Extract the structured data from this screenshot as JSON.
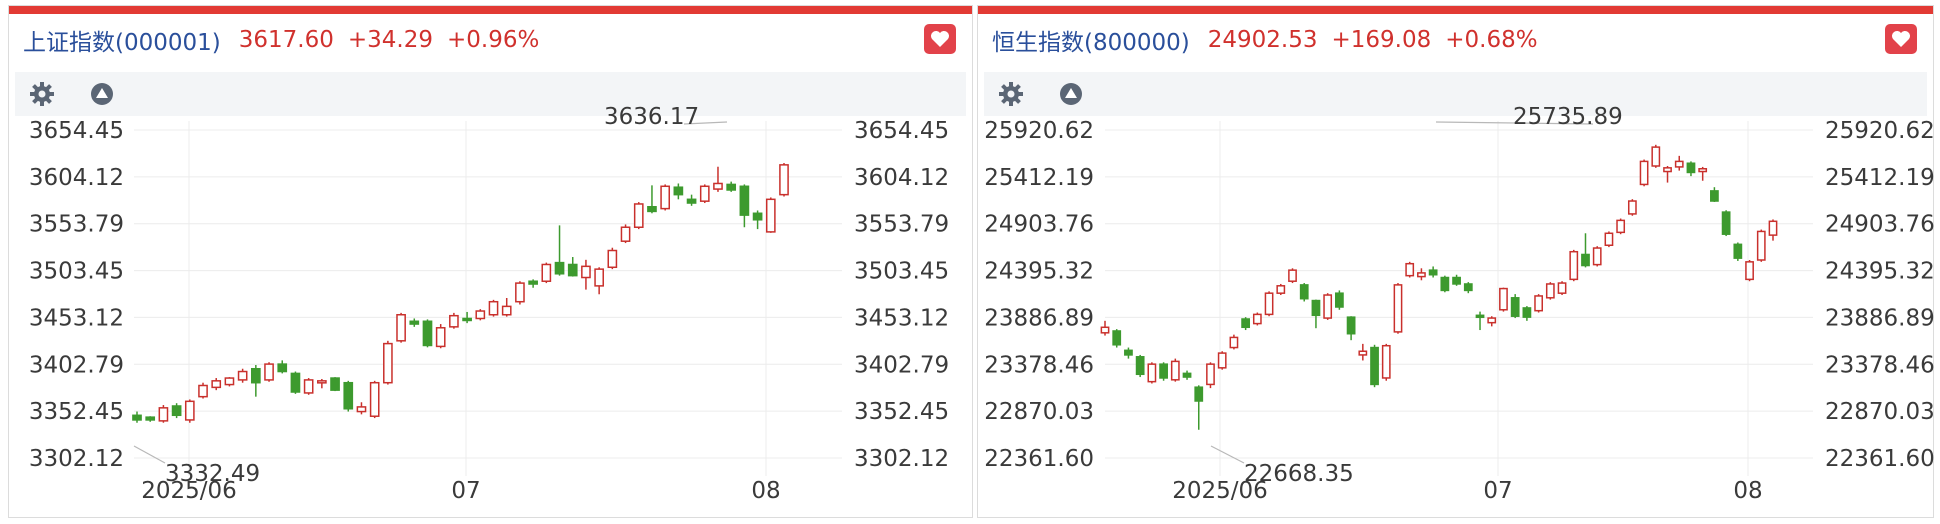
{
  "panels": [
    {
      "header": {
        "name": "上证指数(000001)",
        "price": "3617.60",
        "change": "+34.29",
        "pct": "+0.96%"
      },
      "icons": {
        "favorite": "heart-icon",
        "settings": "gear-icon",
        "toggle": "triangle-up-icon"
      },
      "chart_data": {
        "type": "candlestick",
        "y_ticks": [
          3654.45,
          3604.12,
          3553.79,
          3503.45,
          3453.12,
          3402.79,
          3352.45,
          3302.12
        ],
        "x_ticks": [
          "2025/06",
          "07",
          "08"
        ],
        "ylim": [
          3302.12,
          3654.45
        ],
        "annotations": [
          {
            "label": "3636.17",
            "at": 41
          },
          {
            "label": "3332.49",
            "at": 0
          }
        ],
        "candles": [
          [
            3348,
            3343,
            3352,
            3340
          ],
          [
            3346,
            3343,
            3347,
            3341
          ],
          [
            3342,
            3356,
            3359,
            3340
          ],
          [
            3358,
            3348,
            3361,
            3345
          ],
          [
            3343,
            3363,
            3365,
            3340
          ],
          [
            3368,
            3380,
            3383,
            3366
          ],
          [
            3378,
            3385,
            3388,
            3375
          ],
          [
            3381,
            3388,
            3389,
            3379
          ],
          [
            3386,
            3395,
            3398,
            3383
          ],
          [
            3398,
            3383,
            3402,
            3368
          ],
          [
            3386,
            3403,
            3405,
            3384
          ],
          [
            3403,
            3395,
            3407,
            3393
          ],
          [
            3393,
            3373,
            3395,
            3371
          ],
          [
            3372,
            3386,
            3388,
            3370
          ],
          [
            3383,
            3385,
            3387,
            3377
          ],
          [
            3388,
            3375,
            3389,
            3374
          ],
          [
            3383,
            3355,
            3385,
            3352
          ],
          [
            3352,
            3357,
            3362,
            3349
          ],
          [
            3347,
            3383,
            3385,
            3345
          ],
          [
            3383,
            3425,
            3428,
            3381
          ],
          [
            3428,
            3456,
            3458,
            3426
          ],
          [
            3449,
            3446,
            3452,
            3443
          ],
          [
            3449,
            3423,
            3451,
            3421
          ],
          [
            3422,
            3442,
            3446,
            3420
          ],
          [
            3443,
            3455,
            3458,
            3441
          ],
          [
            3452,
            3450,
            3459,
            3447
          ],
          [
            3452,
            3460,
            3462,
            3450
          ],
          [
            3456,
            3470,
            3472,
            3454
          ],
          [
            3456,
            3465,
            3474,
            3454
          ],
          [
            3470,
            3490,
            3492,
            3467
          ],
          [
            3492,
            3489,
            3494,
            3485
          ],
          [
            3492,
            3510,
            3512,
            3490
          ],
          [
            3512,
            3500,
            3552,
            3498
          ],
          [
            3510,
            3498,
            3518,
            3497
          ],
          [
            3496,
            3508,
            3515,
            3483
          ],
          [
            3487,
            3505,
            3507,
            3478
          ],
          [
            3507,
            3525,
            3528,
            3505
          ],
          [
            3535,
            3550,
            3553,
            3533
          ],
          [
            3550,
            3575,
            3577,
            3548
          ],
          [
            3572,
            3567,
            3595,
            3565
          ],
          [
            3570,
            3594,
            3596,
            3568
          ],
          [
            3593,
            3585,
            3597,
            3580
          ],
          [
            3580,
            3576,
            3585,
            3573
          ],
          [
            3578,
            3594,
            3596,
            3576
          ],
          [
            3591,
            3597,
            3615,
            3588
          ],
          [
            3596,
            3590,
            3599,
            3588
          ],
          [
            3594,
            3563,
            3596,
            3550
          ],
          [
            3565,
            3558,
            3568,
            3548
          ],
          [
            3545,
            3580,
            3582,
            3544
          ],
          [
            3585,
            3617,
            3619,
            3583
          ]
        ]
      }
    },
    {
      "header": {
        "name": "恒生指数(800000)",
        "price": "24902.53",
        "change": "+169.08",
        "pct": "+0.68%"
      },
      "icons": {
        "favorite": "heart-icon",
        "settings": "gear-icon",
        "toggle": "triangle-up-icon"
      },
      "chart_data": {
        "type": "candlestick",
        "y_ticks": [
          25920.62,
          25412.19,
          24903.76,
          24395.32,
          23886.89,
          23378.46,
          22870.03,
          22361.6
        ],
        "x_ticks": [
          "2025/06",
          "07",
          "08"
        ],
        "ylim": [
          22361.6,
          25920.62
        ],
        "annotations": [
          {
            "label": "25735.89",
            "at": 35
          },
          {
            "label": "22668.35",
            "at": 0
          }
        ],
        "candles": [
          [
            23720,
            23780,
            23850,
            23690
          ],
          [
            23740,
            23590,
            23760,
            23560
          ],
          [
            23530,
            23480,
            23560,
            23440
          ],
          [
            23460,
            23270,
            23480,
            23240
          ],
          [
            23190,
            23380,
            23400,
            23170
          ],
          [
            23380,
            23230,
            23400,
            23200
          ],
          [
            23210,
            23410,
            23440,
            23190
          ],
          [
            23280,
            23240,
            23310,
            23210
          ],
          [
            23130,
            22980,
            23150,
            22668
          ],
          [
            23160,
            23380,
            23400,
            23120
          ],
          [
            23340,
            23500,
            23520,
            23320
          ],
          [
            23560,
            23670,
            23700,
            23540
          ],
          [
            23870,
            23780,
            23890,
            23750
          ],
          [
            23820,
            23920,
            23940,
            23800
          ],
          [
            23920,
            24150,
            24170,
            23900
          ],
          [
            24150,
            24230,
            24250,
            24130
          ],
          [
            24280,
            24400,
            24420,
            24260
          ],
          [
            24240,
            24090,
            24260,
            24060
          ],
          [
            24070,
            23910,
            24080,
            23770
          ],
          [
            23880,
            24130,
            24150,
            23860
          ],
          [
            24150,
            24000,
            24180,
            23970
          ],
          [
            23890,
            23710,
            23900,
            23640
          ],
          [
            23480,
            23520,
            23600,
            23420
          ],
          [
            23560,
            23160,
            23590,
            23130
          ],
          [
            23230,
            23580,
            23600,
            23200
          ],
          [
            23730,
            24240,
            24260,
            23710
          ],
          [
            24340,
            24470,
            24490,
            24320
          ],
          [
            24330,
            24370,
            24420,
            24290
          ],
          [
            24400,
            24350,
            24440,
            24320
          ],
          [
            24320,
            24180,
            24340,
            24160
          ],
          [
            24320,
            24250,
            24350,
            24230
          ],
          [
            24250,
            24180,
            24270,
            24150
          ],
          [
            23910,
            23900,
            23950,
            23750
          ],
          [
            23830,
            23880,
            23900,
            23790
          ],
          [
            23970,
            24200,
            24210,
            23950
          ],
          [
            24100,
            23900,
            24140,
            23880
          ],
          [
            23990,
            23890,
            24010,
            23850
          ],
          [
            23960,
            24120,
            24140,
            23940
          ],
          [
            24100,
            24250,
            24270,
            24080
          ],
          [
            24150,
            24260,
            24280,
            24130
          ],
          [
            24300,
            24600,
            24620,
            24280
          ],
          [
            24570,
            24450,
            24800,
            24430
          ],
          [
            24460,
            24640,
            24660,
            24440
          ],
          [
            24670,
            24800,
            24820,
            24650
          ],
          [
            24810,
            24940,
            24960,
            24790
          ],
          [
            25010,
            25150,
            25170,
            24990
          ],
          [
            25330,
            25580,
            25600,
            25310
          ],
          [
            25530,
            25735,
            25760,
            25510
          ],
          [
            25470,
            25510,
            25530,
            25350
          ],
          [
            25520,
            25580,
            25640,
            25480
          ],
          [
            25560,
            25460,
            25580,
            25420
          ],
          [
            25470,
            25500,
            25520,
            25370
          ],
          [
            25260,
            25150,
            25300,
            25140
          ],
          [
            25030,
            24790,
            25050,
            24770
          ],
          [
            24680,
            24530,
            24700,
            24500
          ],
          [
            24300,
            24490,
            24510,
            24280
          ],
          [
            24510,
            24820,
            24840,
            24490
          ],
          [
            24780,
            24930,
            24950,
            24720
          ]
        ]
      }
    }
  ]
}
